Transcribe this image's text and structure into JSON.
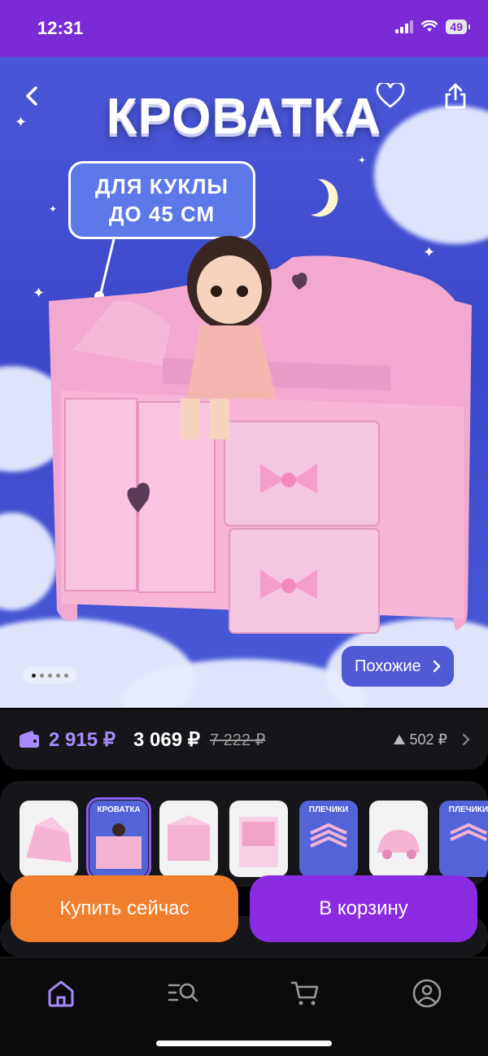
{
  "status_bar": {
    "time": "12:31",
    "battery": "49"
  },
  "hero": {
    "title": "КРОВАТКА",
    "badge_line1": "ДЛЯ КУКЛЫ",
    "badge_line2": "ДО 45 СМ",
    "similar_label": "Похожие",
    "back_icon": "back-arrow-icon",
    "favorite_icon": "heart-icon",
    "share_icon": "share-icon"
  },
  "price": {
    "wallet_price": "2 915 ₽",
    "current_price": "3 069 ₽",
    "old_price": "7 222 ₽",
    "price_drop": "502 ₽"
  },
  "thumbnails": [
    {
      "label": ""
    },
    {
      "label": "КРОВАТКА"
    },
    {
      "label": ""
    },
    {
      "label": ""
    },
    {
      "label": "ПЛЕЧИКИ"
    },
    {
      "label": ""
    },
    {
      "label": "ПЛЕЧИКИ"
    }
  ],
  "actions": {
    "buy_now": "Купить сейчас",
    "add_to_cart": "В корзину"
  },
  "tabbar": {
    "items": [
      "home-icon",
      "catalog-search-icon",
      "cart-icon",
      "profile-icon"
    ]
  },
  "colors": {
    "brand_purple": "#8a2be2",
    "accent_orange": "#f07e2c",
    "wallet_purple": "#a78bfa"
  }
}
